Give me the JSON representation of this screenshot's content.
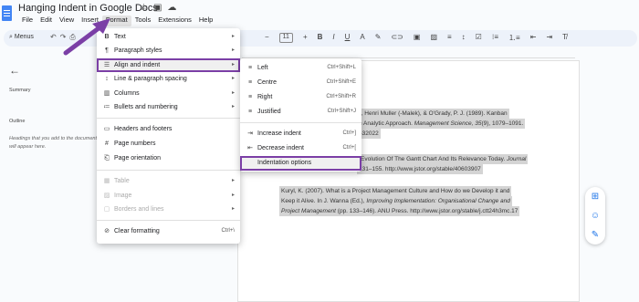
{
  "window": {
    "title": "Hanging Indent in Google Docs",
    "title_icons": [
      "star-icon",
      "folder-icon",
      "cloud-icon"
    ]
  },
  "menubar": [
    "File",
    "Edit",
    "View",
    "Insert",
    "Format",
    "Tools",
    "Extensions",
    "Help"
  ],
  "toolbar": {
    "menus_label": "Menus",
    "font_size": "11"
  },
  "sidebar": {
    "summary_label": "Summary",
    "outline_label": "Outline",
    "outline_hint": "Headings that you add to the document will appear here."
  },
  "format_menu": {
    "items": [
      {
        "icon": "B",
        "label": "Text",
        "arrow": "▸"
      },
      {
        "icon": "¶",
        "label": "Paragraph styles",
        "arrow": "▸"
      },
      {
        "icon": "☰",
        "label": "Align and indent",
        "arrow": "▸"
      },
      {
        "icon": "↕",
        "label": "Line & paragraph spacing",
        "arrow": "▸"
      },
      {
        "icon": "▥",
        "label": "Columns",
        "arrow": "▸"
      },
      {
        "icon": "≔",
        "label": "Bullets and numbering",
        "arrow": "▸"
      },
      {
        "icon": "▭",
        "label": "Headers and footers"
      },
      {
        "icon": "#",
        "label": "Page numbers"
      },
      {
        "icon": "⎗",
        "label": "Page orientation"
      },
      {
        "icon": "▦",
        "label": "Table",
        "arrow": "▸"
      },
      {
        "icon": "▨",
        "label": "Image",
        "arrow": "▸"
      },
      {
        "icon": "▢",
        "label": "Borders and lines",
        "arrow": "▸"
      },
      {
        "icon": "⊘",
        "label": "Clear formatting",
        "shortcut": "Ctrl+\\"
      }
    ]
  },
  "align_submenu": {
    "items": [
      {
        "icon": "≡",
        "label": "Left",
        "shortcut": "Ctrl+Shift+L"
      },
      {
        "icon": "≡",
        "label": "Centre",
        "shortcut": "Ctrl+Shift+E"
      },
      {
        "icon": "≡",
        "label": "Right",
        "shortcut": "Ctrl+Shift+R"
      },
      {
        "icon": "≡",
        "label": "Justified",
        "shortcut": "Ctrl+Shift+J"
      },
      {
        "icon": "⇥",
        "label": "Increase indent",
        "shortcut": "Ctrl+]"
      },
      {
        "icon": "⇤",
        "label": "Decrease indent",
        "shortcut": "Ctrl+["
      },
      {
        "label": "Indentation options"
      }
    ]
  },
  "document": {
    "ref1": "on, T. J., Henri Muller (-Malek), & O'Grady, P. J. (1989). Kanban",
    "ref1b_a": "n Analytic Approach. ",
    "ref1b_b": "Management Science, 35",
    "ref1b_c": "(9), 1079–1091.",
    "ref1c": "632022",
    "ref2": "Evolution Of The Gantt Chart And Its Relevance Today. ",
    "ref2_journal": "Journal",
    "ref2b": "131–155. http://www.jstor.org/stable/40603907",
    "ref3": "Kuryl, K. (2007). What is a Project Management Culture and How do we Develop it and",
    "ref3b_a": "Keep it Alive. In J. Wanna (Ed.), ",
    "ref3b_b": "Improving Implementation: Organisational Change and",
    "ref3c_a": "Project Management",
    "ref3c_b": " (pp. 133–146). ANU Press. http://www.jstor.org/stable/j.ctt24h3mc.17"
  },
  "colors": {
    "accent": "#7b3fa6",
    "highlight_bg": "#d4d4d4",
    "brand": "#4285f4"
  }
}
